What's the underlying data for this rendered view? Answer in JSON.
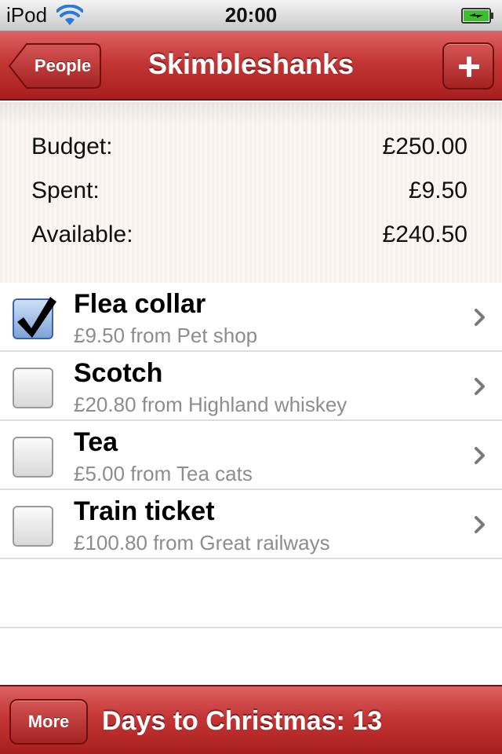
{
  "status_bar": {
    "carrier": "iPod",
    "time": "20:00",
    "wifi_icon": "wifi-icon",
    "battery_icon": "battery-charging-icon"
  },
  "nav": {
    "back_label": "People",
    "title": "Skimbleshanks",
    "add_icon": "plus-icon"
  },
  "summary": {
    "budget_label": "Budget:",
    "budget_value": "£250.00",
    "spent_label": "Spent:",
    "spent_value": "£9.50",
    "available_label": "Available:",
    "available_value": "£240.50"
  },
  "items": [
    {
      "name": "Flea collar",
      "detail": "£9.50 from Pet shop",
      "checked": true
    },
    {
      "name": "Scotch",
      "detail": "£20.80 from Highland whiskey",
      "checked": false
    },
    {
      "name": "Tea",
      "detail": "£5.00 from Tea cats",
      "checked": false
    },
    {
      "name": "Train ticket",
      "detail": "£100.80 from Great railways",
      "checked": false
    }
  ],
  "toolbar": {
    "more_label": "More",
    "days_label": "Days to Christmas: 13"
  },
  "colors": {
    "bar_red": "#c43636",
    "check_blue": "#3d64a8",
    "subtitle_gray": "#8d8d8d"
  }
}
